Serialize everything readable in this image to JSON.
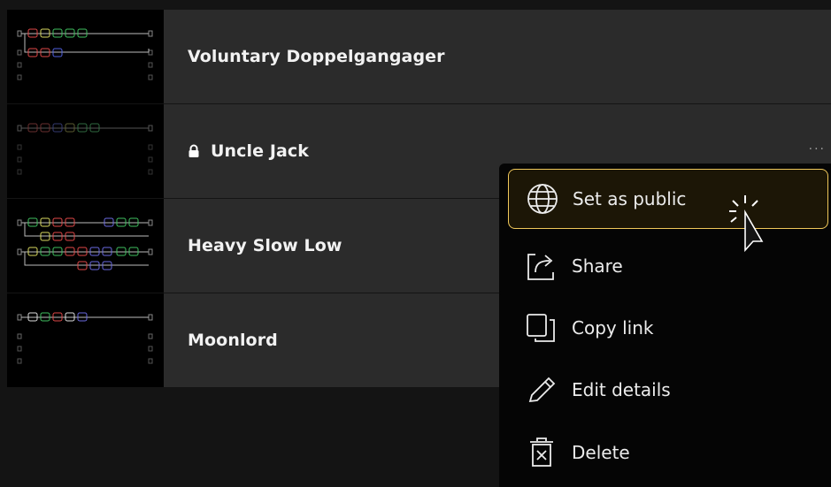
{
  "presets": [
    {
      "name": "Voluntary Doppelgangager",
      "locked": false
    },
    {
      "name": "Uncle Jack",
      "locked": true
    },
    {
      "name": "Heavy Slow Low",
      "locked": false
    },
    {
      "name": "Moonlord",
      "locked": false
    }
  ],
  "more_button": {
    "label": "···"
  },
  "menu": {
    "items": [
      {
        "label": "Set as public",
        "icon": "globe-icon"
      },
      {
        "label": "Share",
        "icon": "share-icon"
      },
      {
        "label": "Copy link",
        "icon": "copy-link-icon"
      },
      {
        "label": "Edit details",
        "icon": "pencil-icon"
      },
      {
        "label": "Delete",
        "icon": "trash-icon"
      }
    ],
    "active_index": 0
  },
  "colors": {
    "row_bg": "#2b2b2b",
    "menu_bg": "#050505",
    "active_border": "#f0c85a",
    "active_bg": "#1c1606"
  }
}
